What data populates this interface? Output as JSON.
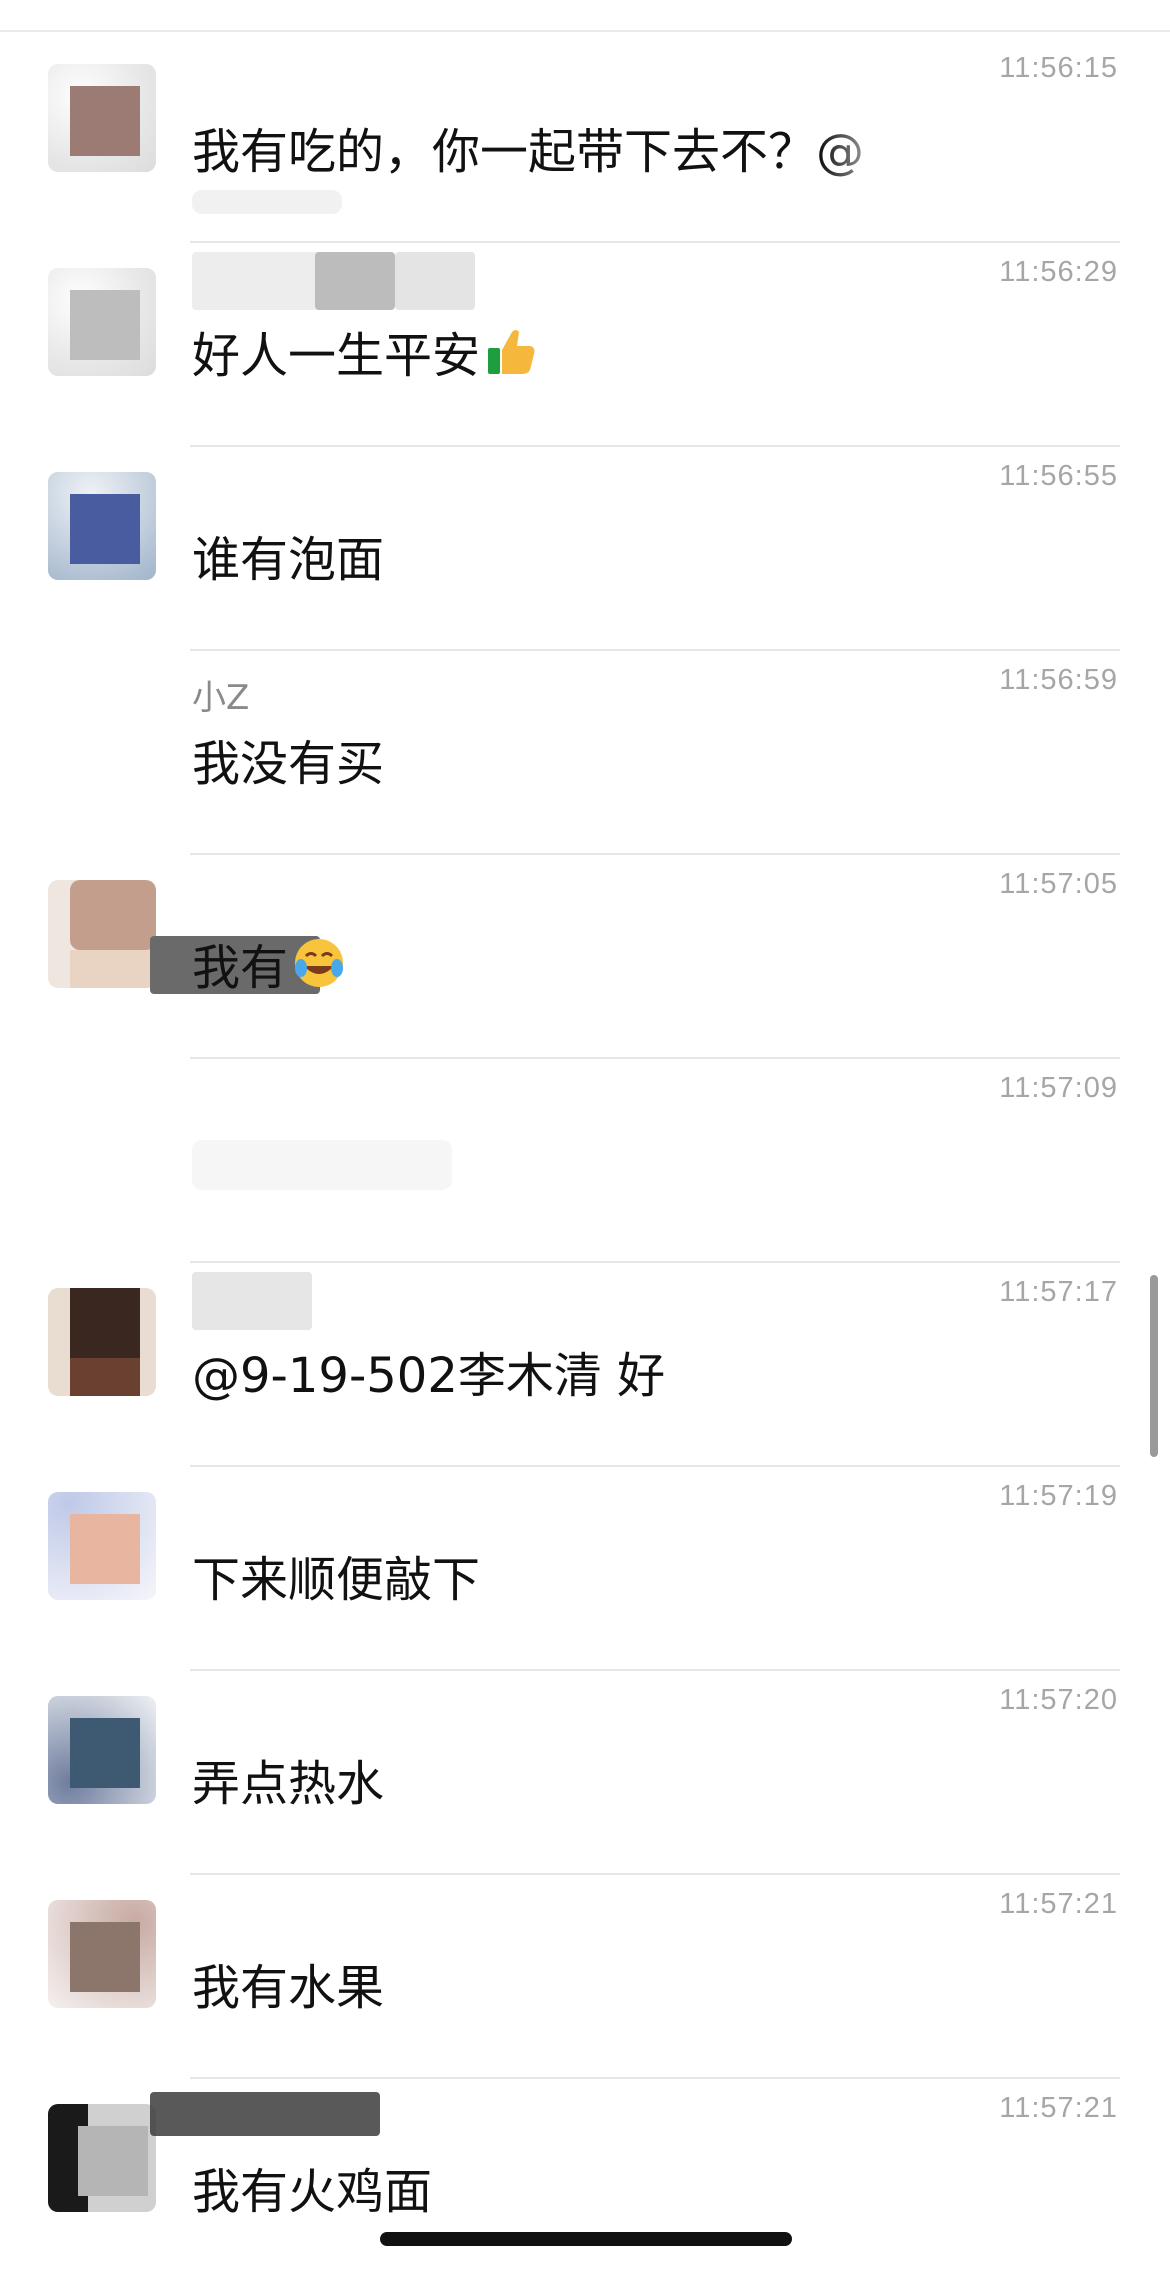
{
  "messages": [
    {
      "time": "11:56:15",
      "sender": "",
      "text": "我有吃的，你一起带下去不？@"
    },
    {
      "time": "11:56:29",
      "sender": "",
      "text": "好人一生平安",
      "emoji": "thumbs-up"
    },
    {
      "time": "11:56:55",
      "sender": "",
      "text": "谁有泡面"
    },
    {
      "time": "11:56:59",
      "sender": "小Z",
      "text": "我没有买"
    },
    {
      "time": "11:57:05",
      "sender": "",
      "text": "我有",
      "emoji": "laughing-crying"
    },
    {
      "time": "11:57:09",
      "sender": "",
      "text": ""
    },
    {
      "time": "11:57:17",
      "sender": "",
      "text": "@9-19-502李木清 好"
    },
    {
      "time": "11:57:19",
      "sender": "",
      "text": "下来顺便敲下"
    },
    {
      "time": "11:57:20",
      "sender": "",
      "text": "弄点热水"
    },
    {
      "time": "11:57:21",
      "sender": "",
      "text": "我有水果"
    },
    {
      "time": "11:57:21",
      "sender": "",
      "text": "我有火鸡面"
    }
  ],
  "colors": {
    "text": "#111111",
    "timestamp": "#a6a6a6",
    "sender": "#8a8a8a",
    "divider": "#e6e6e6"
  }
}
